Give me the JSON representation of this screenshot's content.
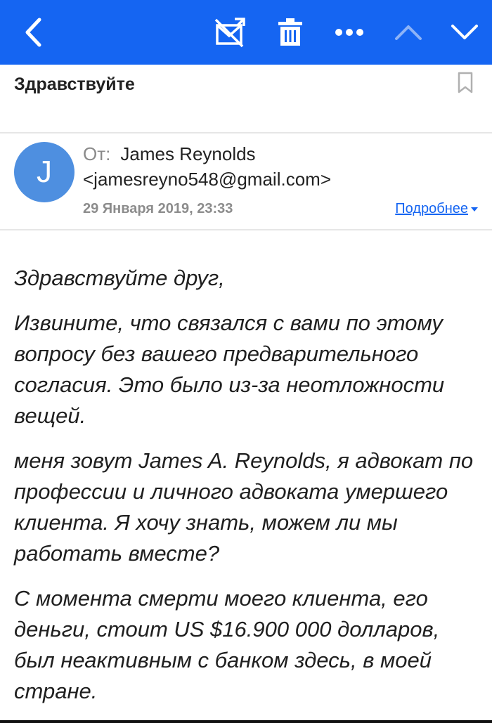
{
  "toolbar": {
    "back_icon": "chevron-left-icon",
    "spam_icon": "mark-spam-icon",
    "trash_icon": "trash-icon",
    "more_icon": "more-horizontal-icon",
    "prev_icon": "chevron-up-icon",
    "next_icon": "chevron-down-icon",
    "bg_color": "#1565f2"
  },
  "subject": "Здравствуйте",
  "sender": {
    "avatar_letter": "J",
    "from_label": "От:",
    "name": "James Reynolds",
    "email": "<jamesreyno548@gmail.com>",
    "date": "29 Января 2019, 23:33",
    "details_label": "Подробнее"
  },
  "body": {
    "p1": "Здравствуйте друг,",
    "p2": "Извините, что связался с вами по этому вопросу без вашего предварительного согласия. Это было из-за неотложности вещей.",
    "p3": "меня зовут James  A. Reynolds, я адвокат по профессии и личного адвоката умершего клиента. Я хочу знать, можем ли мы работать вместе?",
    "p4": "С момента смерти моего клиента, его деньги, стоит US $16.900 000 долларов, был неактивным с банком здесь, в моей стране."
  }
}
